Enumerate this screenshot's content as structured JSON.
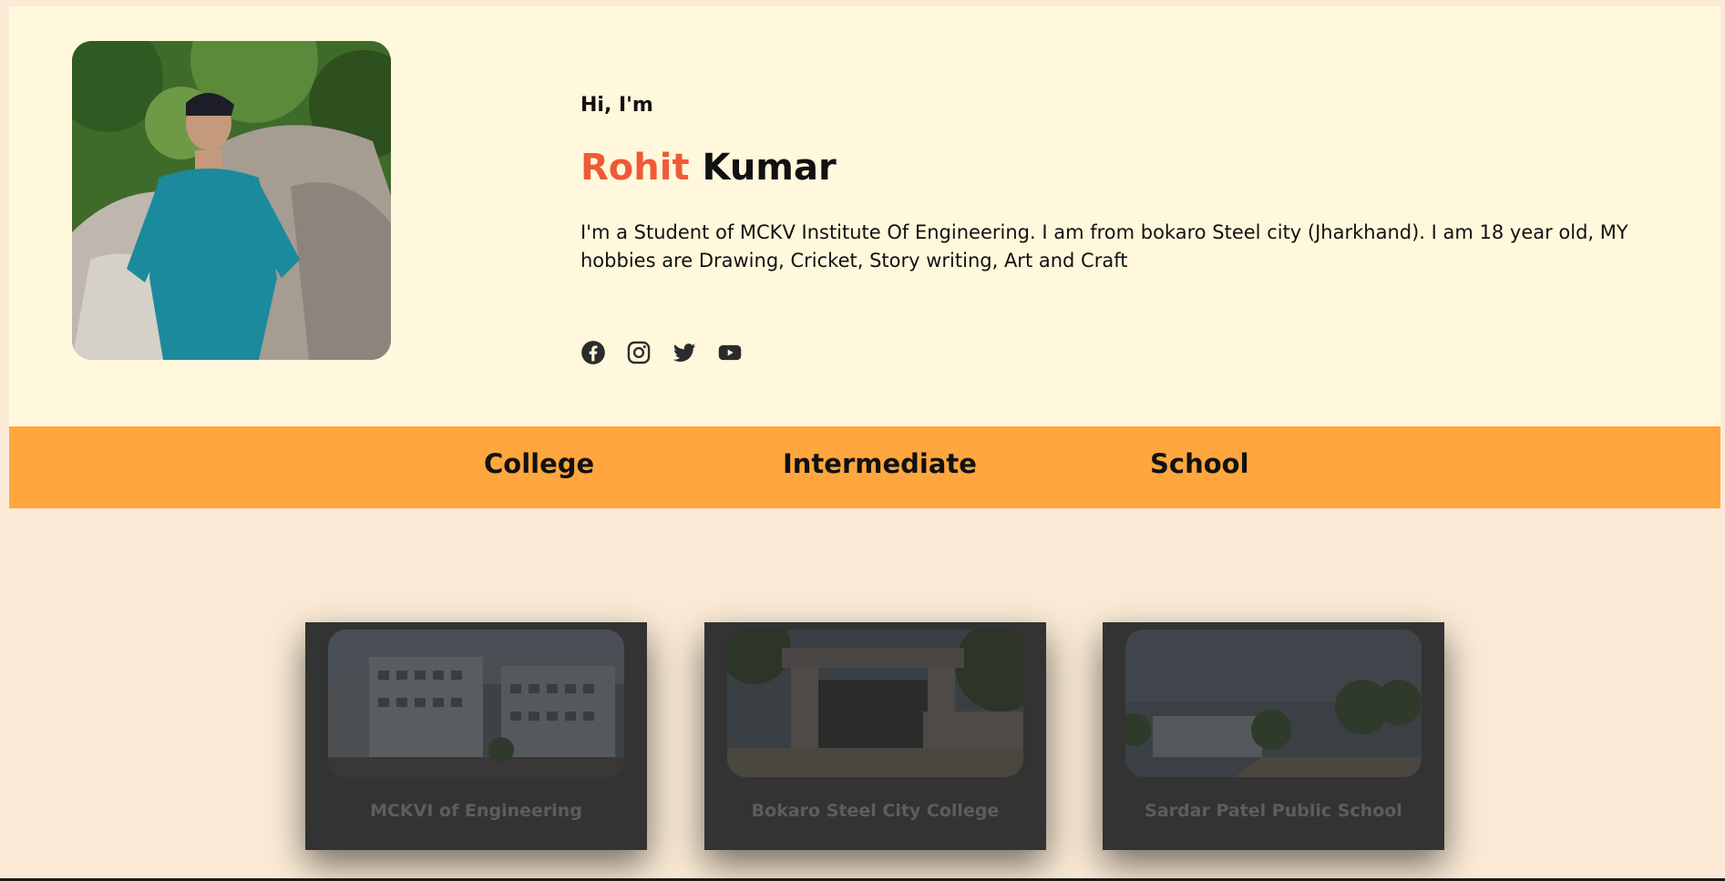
{
  "hero": {
    "greeting": "Hi, I'm",
    "first_name": "Rohit",
    "last_name": "Kumar",
    "bio": "I'm a Student of MCKV Institute Of Engineering. I am from bokaro Steel city (Jharkhand). I am 18 year old, MY hobbies are Drawing, Cricket, Story writing, Art and Craft",
    "socials": [
      "facebook-icon",
      "instagram-icon",
      "twitter-icon",
      "youtube-icon"
    ]
  },
  "tabs": [
    "College",
    "Intermediate",
    "School"
  ],
  "cards": [
    {
      "caption": "MCKVI of Engineering"
    },
    {
      "caption": "Bokaro Steel City College"
    },
    {
      "caption": "Sardar Patel Public School"
    }
  ],
  "colors": {
    "accent": "#ef5a36",
    "tab_bar": "#ffa63e",
    "hero_bg": "#fff8dc",
    "page_bg": "#fbebd6",
    "card_bg": "#333333"
  }
}
